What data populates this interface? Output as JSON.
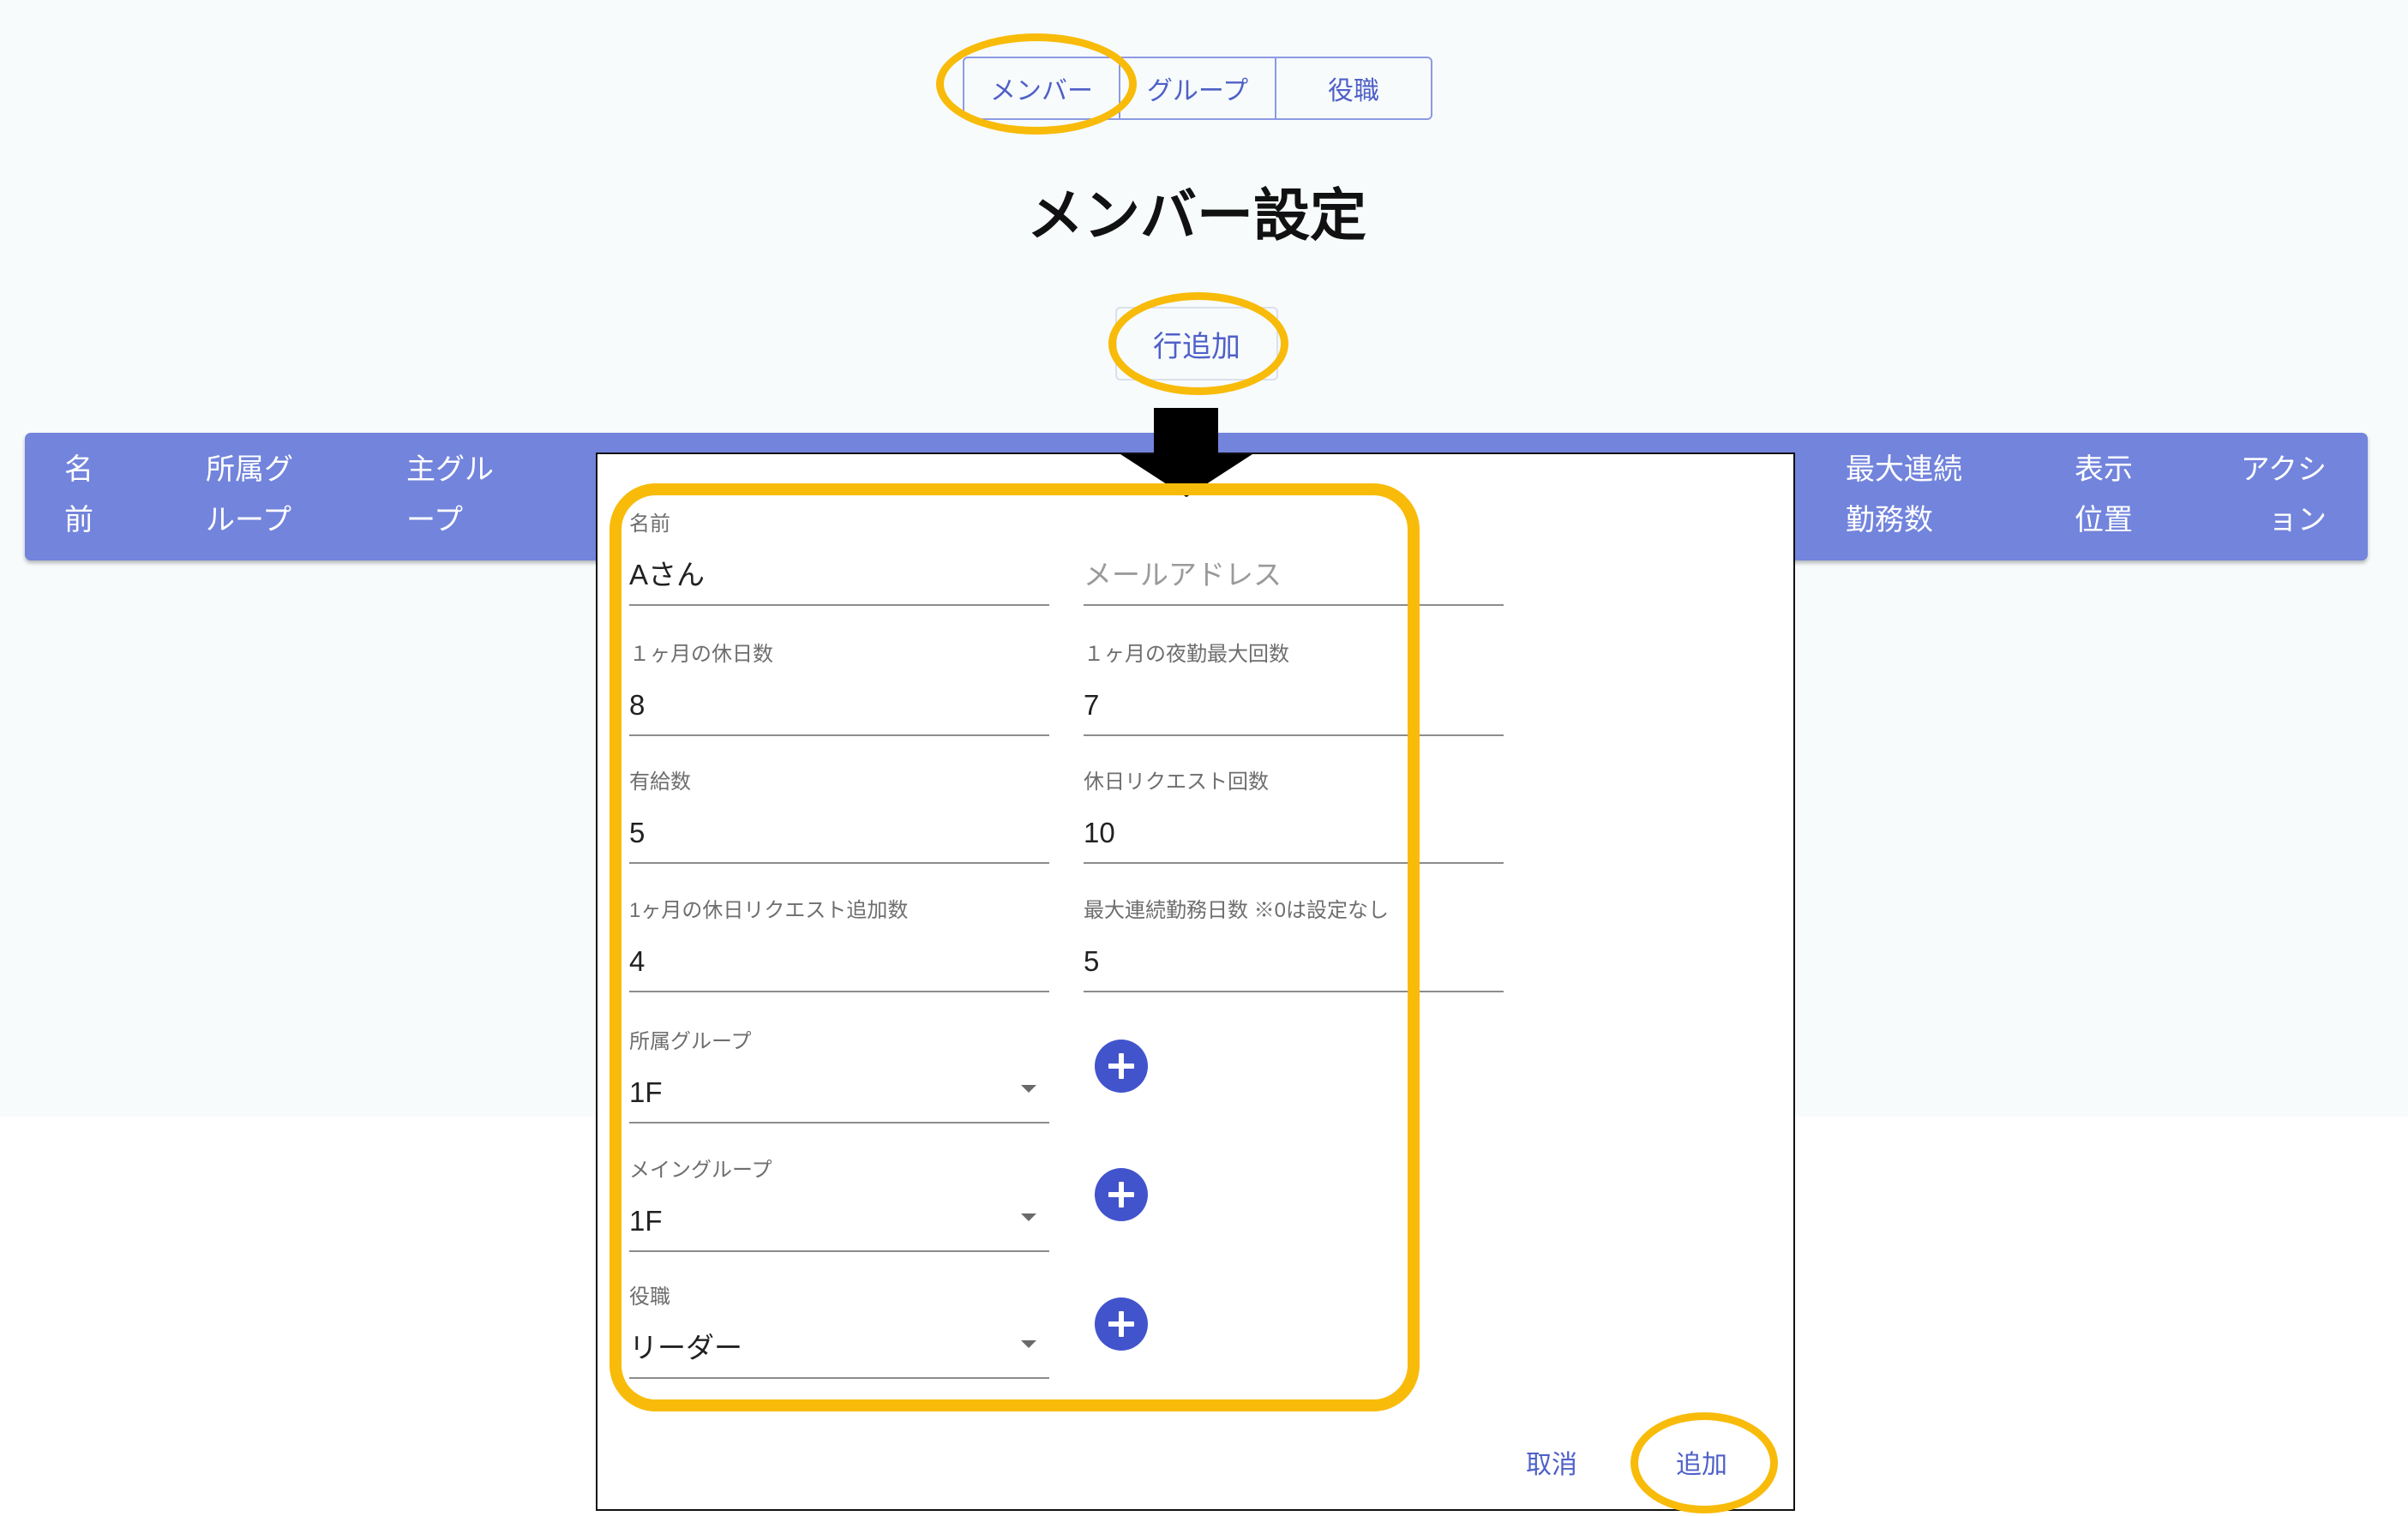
{
  "tabs": [
    {
      "label": "メンバー"
    },
    {
      "label": "グループ"
    },
    {
      "label": "役職"
    }
  ],
  "page_title": "メンバー設定",
  "add_row_label": "行追加",
  "table": {
    "columns": [
      {
        "lines": [
          "名",
          "前"
        ]
      },
      {
        "lines": [
          "所属グ",
          "ループ"
        ]
      },
      {
        "lines": [
          "主グル",
          "ープ"
        ]
      },
      {
        "lines": [
          "最大連続",
          "勤務数"
        ]
      },
      {
        "lines": [
          "表示",
          "位置"
        ]
      },
      {
        "lines": [
          "アクシ",
          "ョン"
        ]
      }
    ]
  },
  "form": {
    "name": {
      "label": "名前",
      "value": "Aさん"
    },
    "email": {
      "placeholder": "メールアドレス"
    },
    "monthly_holidays": {
      "label": "１ヶ月の休日数",
      "value": "8"
    },
    "monthly_night_shift_max": {
      "label": "１ヶ月の夜勤最大回数",
      "value": "7"
    },
    "paid_leave": {
      "label": "有給数",
      "value": "5"
    },
    "holiday_requests": {
      "label": "休日リクエスト回数",
      "value": "10"
    },
    "monthly_extra_holiday_requests": {
      "label": "1ヶ月の休日リクエスト追加数",
      "value": "4"
    },
    "max_consecutive_workdays": {
      "label": "最大連続勤務日数 ※0は設定なし",
      "value": "5"
    },
    "group": {
      "label": "所属グループ",
      "value": "1F"
    },
    "main_group": {
      "label": "メイングループ",
      "value": "1F"
    },
    "role": {
      "label": "役職",
      "value": "リーダー"
    }
  },
  "dialog_actions": {
    "cancel": "取消",
    "add": "追加"
  },
  "icons": {
    "add_button": "plus-icon",
    "select_dropdown": "arrow-drop-down-icon",
    "flow_arrow": "arrow-down-icon"
  },
  "colors": {
    "accent": "#4f60c8",
    "tab_border": "#8e9ae4",
    "header_bg": "#7284dc",
    "fab": "#4254cc",
    "highlight": "#f8bb0a"
  }
}
